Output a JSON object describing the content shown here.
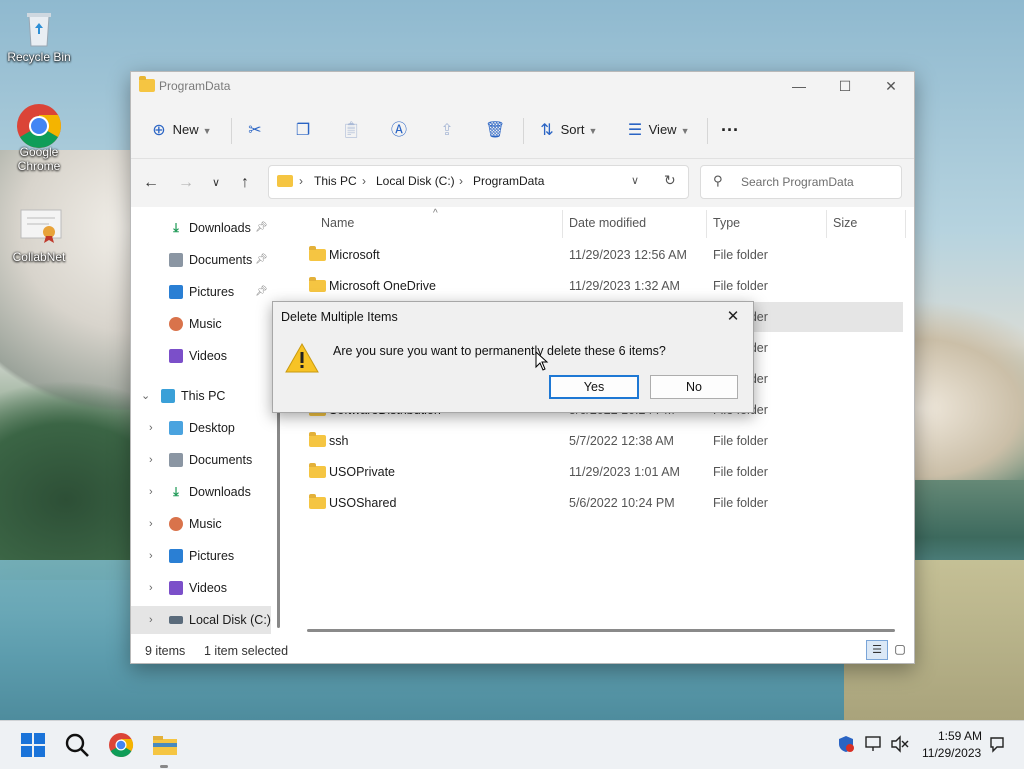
{
  "desktop": {
    "icons": [
      {
        "label": "Recycle Bin"
      },
      {
        "label": "Google Chrome"
      },
      {
        "label": "CollabNet"
      }
    ]
  },
  "window": {
    "title": "ProgramData",
    "controls": {
      "minimize": "—",
      "maximize": "☐",
      "close": "✕"
    }
  },
  "toolbar": {
    "new_label": "New",
    "sort_label": "Sort",
    "view_label": "View",
    "more_label": "···"
  },
  "address": {
    "crumbs": [
      "This PC",
      "Local Disk (C:)",
      "ProgramData"
    ],
    "separator": "›"
  },
  "search": {
    "placeholder": "Search ProgramData"
  },
  "nav": {
    "quick": [
      {
        "label": "Downloads",
        "icon": "download-icon"
      },
      {
        "label": "Documents",
        "icon": "document-icon"
      },
      {
        "label": "Pictures",
        "icon": "pictures-icon"
      },
      {
        "label": "Music",
        "icon": "music-icon"
      },
      {
        "label": "Videos",
        "icon": "videos-icon"
      }
    ],
    "this_pc": "This PC",
    "pc_items": [
      {
        "label": "Desktop",
        "icon": "desktop-icon"
      },
      {
        "label": "Documents",
        "icon": "document-icon"
      },
      {
        "label": "Downloads",
        "icon": "download-icon"
      },
      {
        "label": "Music",
        "icon": "music-icon"
      },
      {
        "label": "Pictures",
        "icon": "pictures-icon"
      },
      {
        "label": "Videos",
        "icon": "videos-icon"
      },
      {
        "label": "Local Disk (C:)",
        "icon": "drive-icon"
      }
    ]
  },
  "columns": {
    "name": "Name",
    "date": "Date modified",
    "type": "Type",
    "size": "Size"
  },
  "files": [
    {
      "name": "Microsoft",
      "date": "11/29/2023 12:56 AM",
      "type": "File folder"
    },
    {
      "name": "Microsoft OneDrive",
      "date": "11/29/2023 1:32 AM",
      "type": "File folder"
    },
    {
      "name": "",
      "date": "",
      "type": "File folder"
    },
    {
      "name": "",
      "date": "",
      "type": "File folder"
    },
    {
      "name": "",
      "date": "",
      "type": "File folder"
    },
    {
      "name": "SoftwareDistribution",
      "date": "5/6/2022 10:24 PM",
      "type": "File folder"
    },
    {
      "name": "ssh",
      "date": "5/7/2022 12:38 AM",
      "type": "File folder"
    },
    {
      "name": "USOPrivate",
      "date": "11/29/2023 1:01 AM",
      "type": "File folder"
    },
    {
      "name": "USOShared",
      "date": "5/6/2022 10:24 PM",
      "type": "File folder"
    }
  ],
  "status": {
    "count": "9 items",
    "selected": "1 item selected"
  },
  "dialog": {
    "title": "Delete Multiple Items",
    "message": "Are you sure you want to permanently delete these 6 items?",
    "yes": "Yes",
    "no": "No",
    "close": "✕"
  },
  "tray": {
    "time": "1:59 AM",
    "date": "11/29/2023"
  },
  "colors": {
    "accent": "#1e78d4",
    "folder": "#f5c542"
  }
}
